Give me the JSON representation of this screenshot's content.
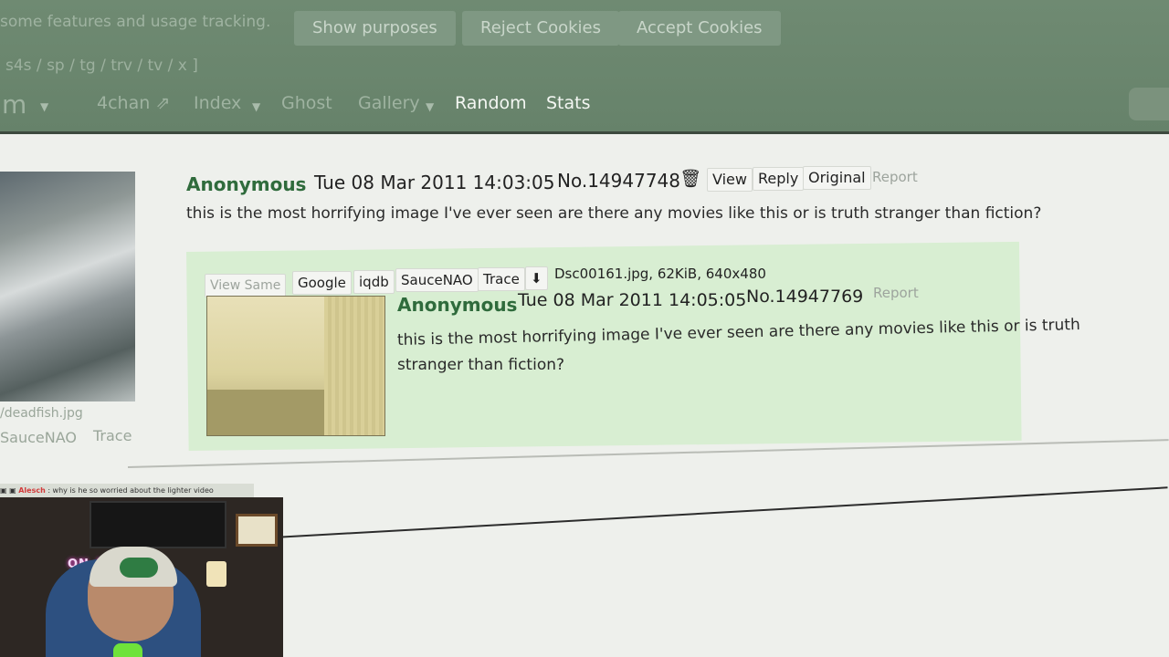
{
  "cookie_banner": {
    "text": "some features and usage tracking.",
    "buttons": [
      "Show purposes",
      "Reject Cookies",
      "Accept Cookies"
    ]
  },
  "boards_line": "s4s / sp / tg / trv / tv / x ]",
  "nav": {
    "board": "m",
    "items": [
      "4chan",
      "Index",
      "Ghost",
      "Gallery",
      "Random",
      "Stats"
    ]
  },
  "op": {
    "filename": "/deadfish.jpg",
    "links": [
      "SauceNAO",
      "Trace"
    ],
    "name": "Anonymous",
    "date": "Tue 08 Mar 2011 14:03:05",
    "number": "No.14947748",
    "buttons": [
      "View",
      "Reply",
      "Original",
      "Report"
    ],
    "text": "this is the most horrifying image I've ever seen are there any movies like this or is truth stranger than fiction?"
  },
  "reply": {
    "file_buttons": [
      "View Same",
      "Google",
      "iqdb",
      "SauceNAO",
      "Trace"
    ],
    "file_info": "Dsc00161.jpg, 62KiB, 640x480",
    "name": "Anonymous",
    "date": "Tue 08 Mar 2011 14:05:05",
    "number": "No.14947769",
    "report": "Report",
    "text_line1": "this is the most horrifying image I've ever seen are there any movies like this or is truth",
    "text_line2": "stranger than fiction?"
  },
  "stream_chat": {
    "user": "Alesch",
    "message": ": why is he so worried about the lighter video"
  },
  "webcam": {
    "neon_sign": "ON AIR"
  },
  "colors": {
    "header": "#6f8a72",
    "name_green": "#2f6b3c",
    "reply_bg": "#d8eed2"
  }
}
